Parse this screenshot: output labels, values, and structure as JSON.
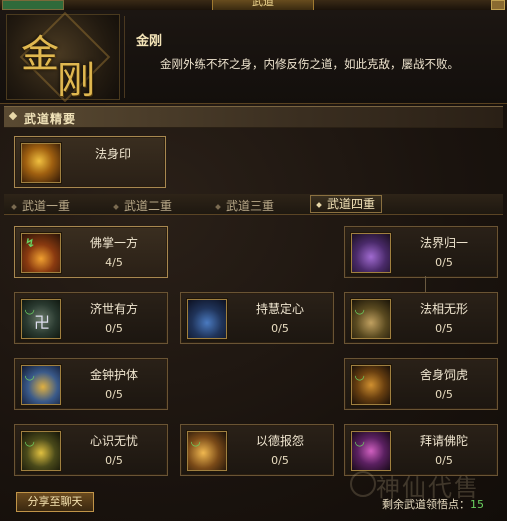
{
  "window": {
    "title": "武道"
  },
  "emblem": {
    "char1": "金",
    "char2": "刚"
  },
  "skill": {
    "name": "金刚",
    "description": "金刚外练不坏之身，内修反伤之道，如此克敌，屡战不败。"
  },
  "section": {
    "title": "武道精要"
  },
  "essence": {
    "name": "法身印"
  },
  "tabs": [
    {
      "label": "武道一重",
      "selected": false
    },
    {
      "label": "武道二重",
      "selected": false
    },
    {
      "label": "武道三重",
      "selected": false
    },
    {
      "label": "武道四重",
      "selected": true
    }
  ],
  "skills": [
    {
      "name": "佛掌一方",
      "count": "4/5",
      "icon": "palm-icon"
    },
    {
      "name": "法界归一",
      "count": "0/5",
      "icon": "realm-icon"
    },
    {
      "name": "济世有方",
      "count": "0/5",
      "icon": "swastika-icon"
    },
    {
      "name": "持慧定心",
      "count": "0/5",
      "icon": "wisdom-icon"
    },
    {
      "name": "法相无形",
      "count": "0/5",
      "icon": "form-icon"
    },
    {
      "name": "金钟护体",
      "count": "0/5",
      "icon": "bell-icon"
    },
    {
      "name": "舍身饲虎",
      "count": "0/5",
      "icon": "tiger-icon"
    },
    {
      "name": "心识无忧",
      "count": "0/5",
      "icon": "mind-icon"
    },
    {
      "name": "以德报怨",
      "count": "0/5",
      "icon": "virtue-icon"
    },
    {
      "name": "拜请佛陀",
      "count": "0/5",
      "icon": "buddha-icon"
    }
  ],
  "footer": {
    "share_label": "分享至聊天",
    "remain_label": "剩余武道领悟点：",
    "remain_value": "15"
  },
  "watermark": {
    "text": "神仙代售"
  },
  "colors": {
    "accent": "#a88850",
    "highlight": "#6ad060",
    "panel": "#1c1610"
  }
}
